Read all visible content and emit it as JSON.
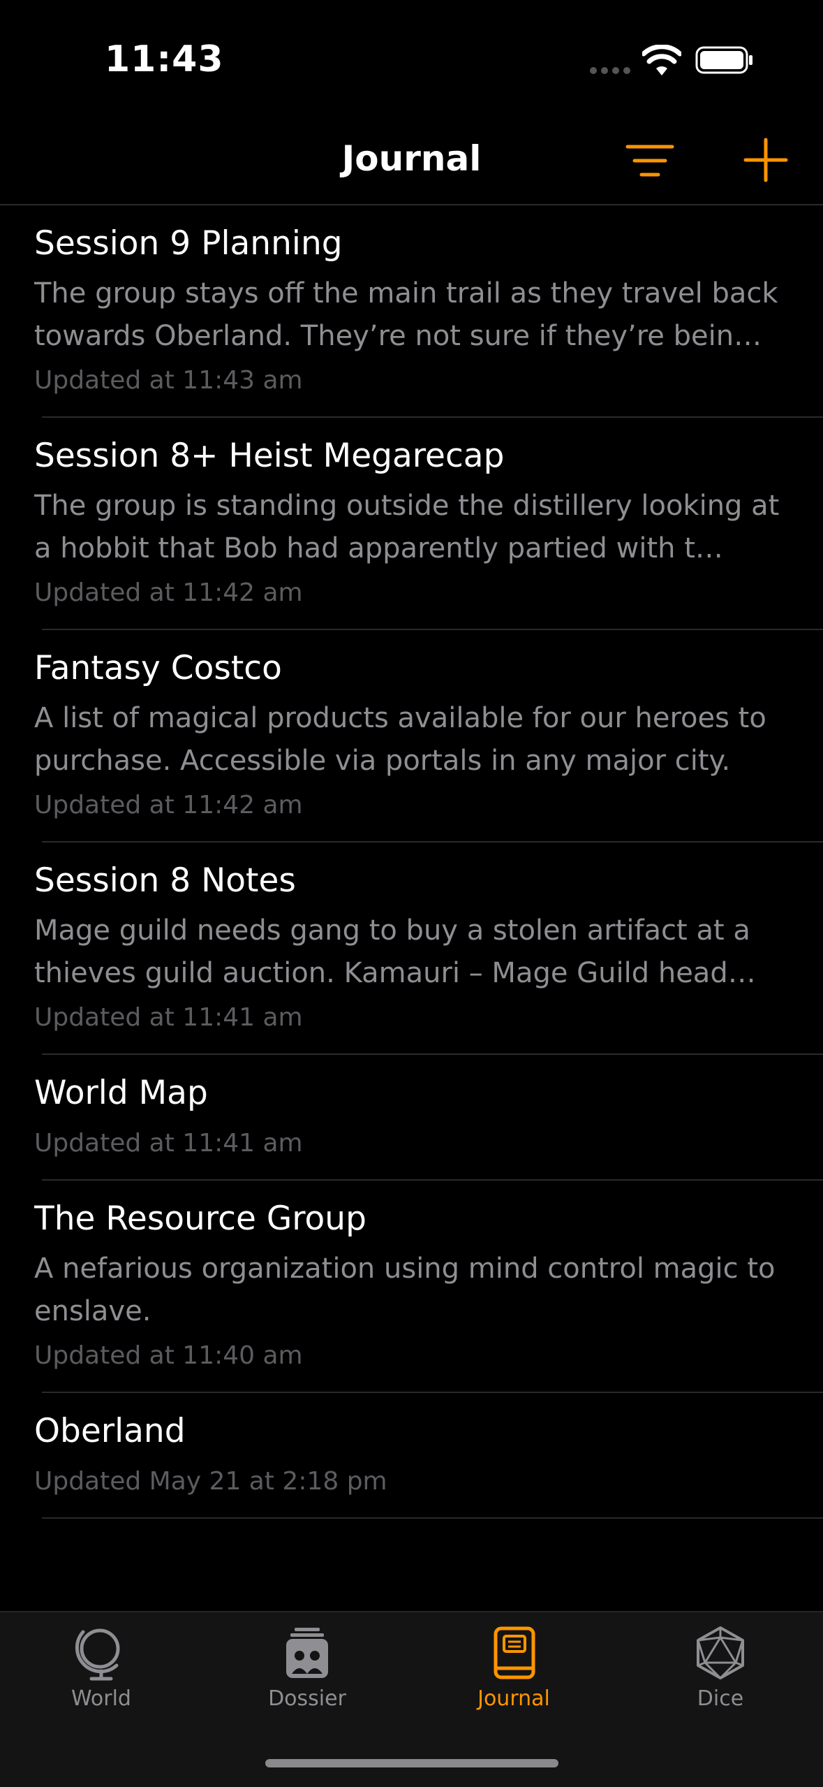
{
  "status": {
    "time": "11:43"
  },
  "nav": {
    "title": "Journal"
  },
  "colors": {
    "accent": "#ff9500",
    "secondary_text": "#8e8e93",
    "meta_text": "#5c5c60",
    "separator": "#2a2a2c"
  },
  "entries": [
    {
      "title": "Session 9 Planning",
      "preview": "The group stays off the main trail as they travel back towards Oberland. They’re not sure if they’re bein…",
      "updated": "Updated at 11:43 am"
    },
    {
      "title": "Session 8+ Heist Megarecap",
      "preview": "The group is standing outside the distillery looking at a hobbit that Bob had apparently partied with t…",
      "updated": "Updated at 11:42 am"
    },
    {
      "title": "Fantasy Costco",
      "preview": "A list of magical products available for our heroes to purchase. Accessible via portals in any major city.",
      "updated": "Updated at 11:42 am"
    },
    {
      "title": "Session 8 Notes",
      "preview": "Mage guild needs gang to buy a stolen artifact at a thieves guild auction. Kamauri – Mage Guild head…",
      "updated": "Updated at 11:41 am"
    },
    {
      "title": "World Map",
      "preview": "",
      "updated": "Updated at 11:41 am"
    },
    {
      "title": "The Resource Group",
      "preview": "A nefarious organization using mind control magic to enslave.",
      "updated": "Updated at 11:40 am"
    },
    {
      "title": "Oberland",
      "preview": "",
      "updated": "Updated May 21 at 2:18 pm"
    }
  ],
  "tabs": [
    {
      "label": "World",
      "icon": "globe-icon",
      "active": false
    },
    {
      "label": "Dossier",
      "icon": "dossier-icon",
      "active": false
    },
    {
      "label": "Journal",
      "icon": "book-icon",
      "active": true
    },
    {
      "label": "Dice",
      "icon": "d20-icon",
      "active": false
    }
  ]
}
